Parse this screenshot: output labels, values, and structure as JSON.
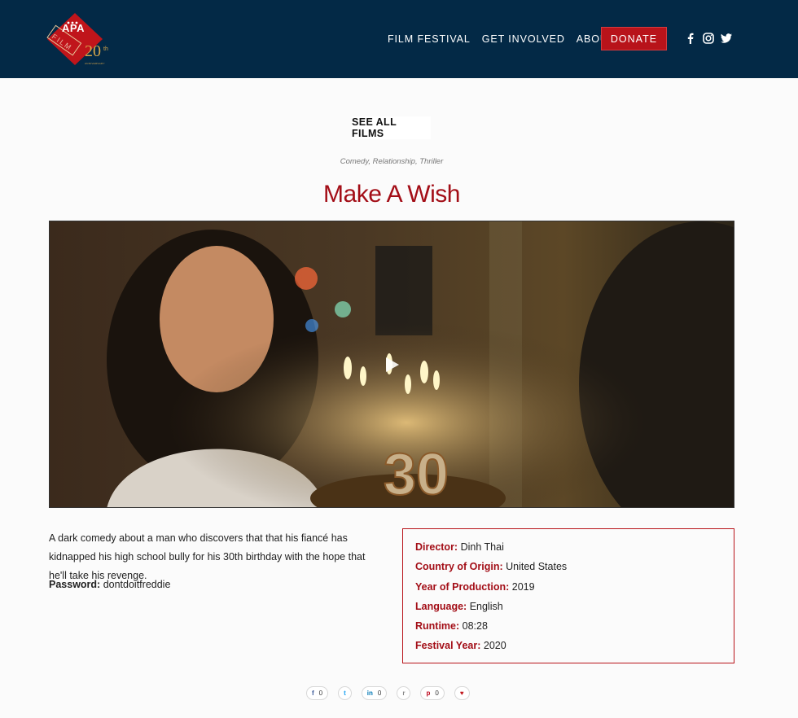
{
  "header": {
    "logo": {
      "text_top": "APA",
      "text_film": "FILM",
      "anniversary": "20",
      "anniversary_sup": "th",
      "anniversary_word": "ANNIVERSARY"
    },
    "nav": [
      {
        "label": "FILM FESTIVAL"
      },
      {
        "label": "GET INVOLVED"
      },
      {
        "label": "ABOUT"
      }
    ],
    "donate_label": "DONATE",
    "social_icons": [
      "facebook-icon",
      "instagram-icon",
      "twitter-icon"
    ]
  },
  "main": {
    "see_all_label": "SEE ALL FILMS",
    "genres": "Comedy, Relationship, Thriller",
    "title": "Make A Wish",
    "description": "A dark comedy about a man who discovers that that his fiancé has kidnapped his high school bully for his 30th birthday with the hope that he'll take his revenge.",
    "password_label": "Password:",
    "password_value": "dontdoitfreddie"
  },
  "details": [
    {
      "key": "Director:",
      "value": "Dinh Thai"
    },
    {
      "key": "Country of Origin:",
      "value": "United States"
    },
    {
      "key": "Year of Production:",
      "value": "2019"
    },
    {
      "key": "Language:",
      "value": "English"
    },
    {
      "key": "Runtime:",
      "value": "08:28"
    },
    {
      "key": "Festival Year:",
      "value": "2020"
    }
  ],
  "shares": [
    {
      "icon": "f",
      "count": "0"
    },
    {
      "icon": "t",
      "count": ""
    },
    {
      "icon": "in",
      "count": "0"
    },
    {
      "icon": "r",
      "count": ""
    },
    {
      "icon": "p",
      "count": "0"
    },
    {
      "icon": "♥",
      "count": ""
    }
  ],
  "colors": {
    "header_bg": "#032946",
    "accent": "#b8131a",
    "title": "#a30e17"
  }
}
